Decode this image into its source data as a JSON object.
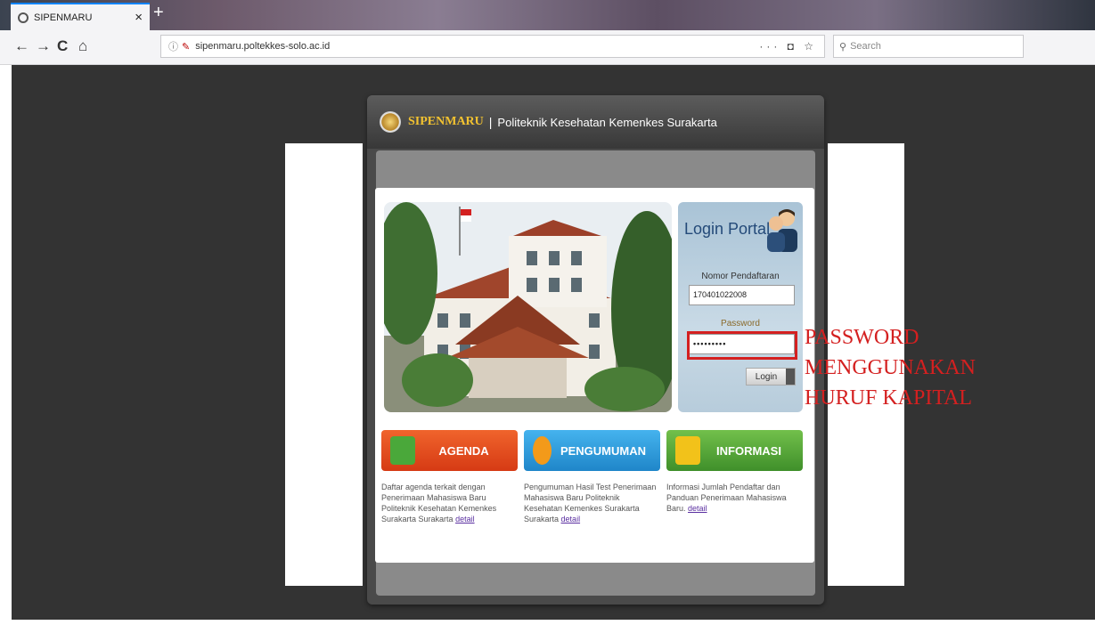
{
  "browser": {
    "tab_title": "SIPENMARU",
    "tab_close": "×",
    "new_tab": "+",
    "back": "←",
    "forward": "→",
    "reload": "C",
    "home": "⌂",
    "url": "sipenmaru.poltekkes-solo.ac.id",
    "page_actions": "··· ◘ ☆",
    "search_placeholder": "Search"
  },
  "header": {
    "site_name": "SIPENMARU",
    "separator": "|",
    "institution": "Politeknik Kesehatan Kemenkes Surakarta"
  },
  "login": {
    "title": "Login Portal",
    "nomor_label": "Nomor Pendaftaran",
    "nomor_value": "170401022008",
    "password_label": "Password",
    "password_value": "•••••••••",
    "button_label": "Login"
  },
  "annotation": {
    "line1": "PASSWORD MENGGUNAKAN",
    "line2": "HURUF KAPITAL",
    "color": "#d42020"
  },
  "tiles": [
    {
      "label": "AGENDA",
      "color": "#e8491d",
      "desc": "Daftar agenda terkait dengan Penerimaan Mahasiswa Baru Politeknik Kesehatan Kemenkes Surakarta Surakarta",
      "link": "detail"
    },
    {
      "label": "PENGUMUMAN",
      "color": "#2d9de0",
      "desc": "Pengumuman Hasil Test Penerimaan Mahasiswa Baru Politeknik Kesehatan Kemenkes Surakarta Surakarta",
      "link": "detail"
    },
    {
      "label": "INFORMASI",
      "color": "#5aa93a",
      "desc": "Informasi Jumlah Pendaftar dan Panduan Penerimaan Mahasiswa Baru.",
      "link": "detail"
    }
  ]
}
